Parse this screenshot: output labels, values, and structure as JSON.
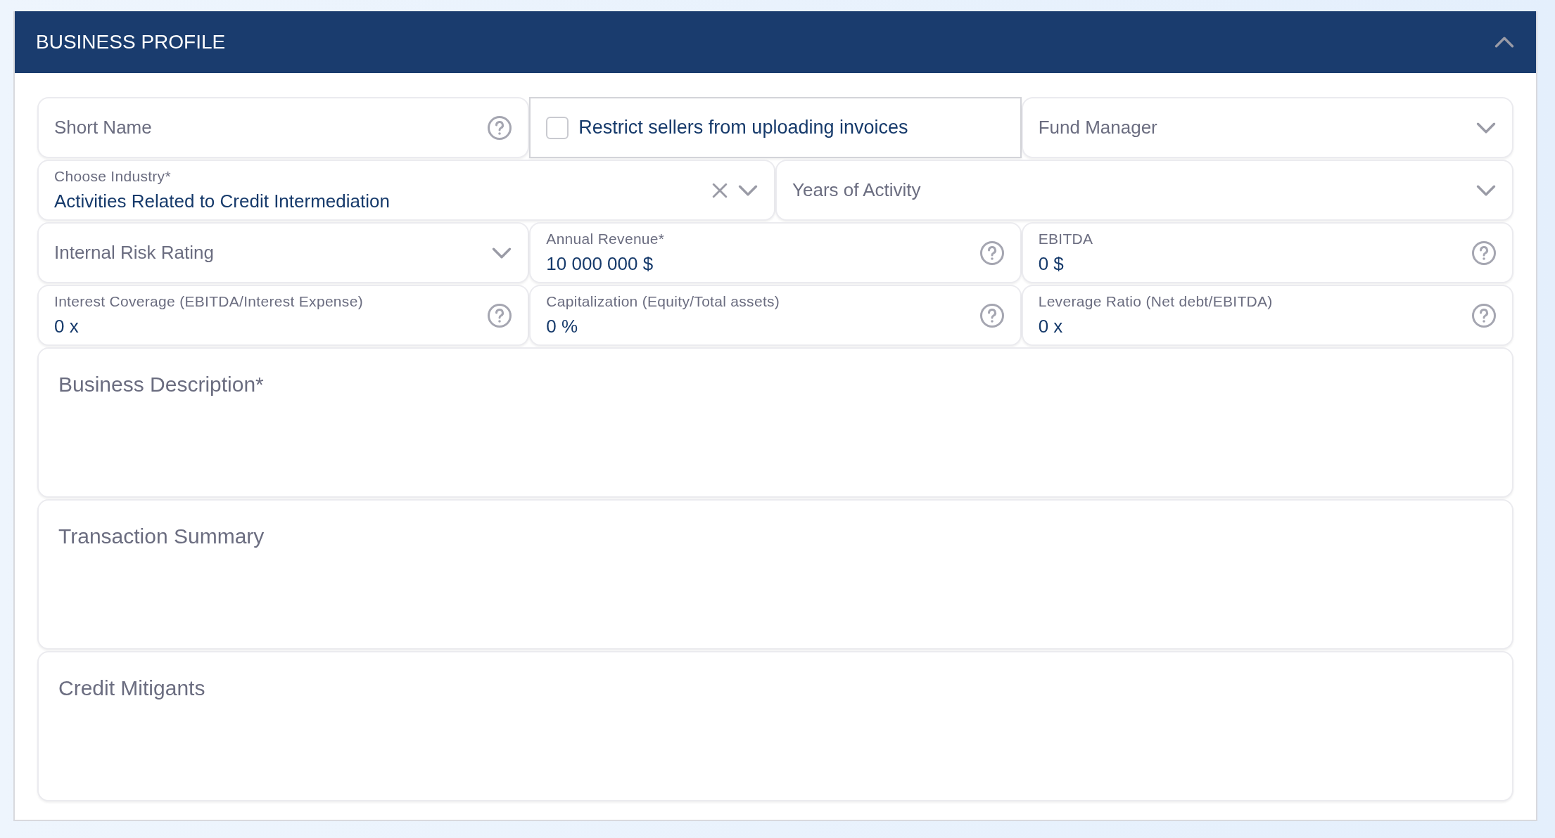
{
  "panel": {
    "title": "BUSINESS PROFILE",
    "expanded": true
  },
  "rows": [
    {
      "fields": [
        {
          "kind": "text",
          "placeholder": "Short Name",
          "help": true
        },
        {
          "kind": "checkbox",
          "label": "Restrict sellers from uploading invoices",
          "checked": false
        },
        {
          "kind": "select",
          "placeholder": "Fund Manager"
        }
      ]
    },
    {
      "fields": [
        {
          "kind": "select",
          "label": "Choose Industry*",
          "value": "Activities Related to Credit Intermediation",
          "clearable": true
        },
        {
          "kind": "select",
          "placeholder": "Years of Activity"
        }
      ]
    },
    {
      "fields": [
        {
          "kind": "select",
          "placeholder": "Internal Risk Rating"
        },
        {
          "kind": "text",
          "label": "Annual Revenue*",
          "value": "10 000 000 $",
          "help": true
        },
        {
          "kind": "text",
          "label": "EBITDA",
          "value": "0 $",
          "help": true
        }
      ]
    },
    {
      "fields": [
        {
          "kind": "text",
          "label": "Interest Coverage (EBITDA/Interest Expense)",
          "value": "0 x",
          "help": true
        },
        {
          "kind": "text",
          "label": "Capitalization (Equity/Total assets)",
          "value": "0 %",
          "help": true
        },
        {
          "kind": "text",
          "label": "Leverage Ratio (Net debt/EBITDA)",
          "value": "0 x",
          "help": true
        }
      ]
    },
    {
      "fields": [
        {
          "kind": "textarea",
          "placeholder": "Business Description*"
        }
      ]
    },
    {
      "fields": [
        {
          "kind": "textarea",
          "placeholder": "Transaction Summary"
        }
      ]
    },
    {
      "fields": [
        {
          "kind": "textarea",
          "placeholder": "Credit Mitigants"
        }
      ]
    }
  ]
}
